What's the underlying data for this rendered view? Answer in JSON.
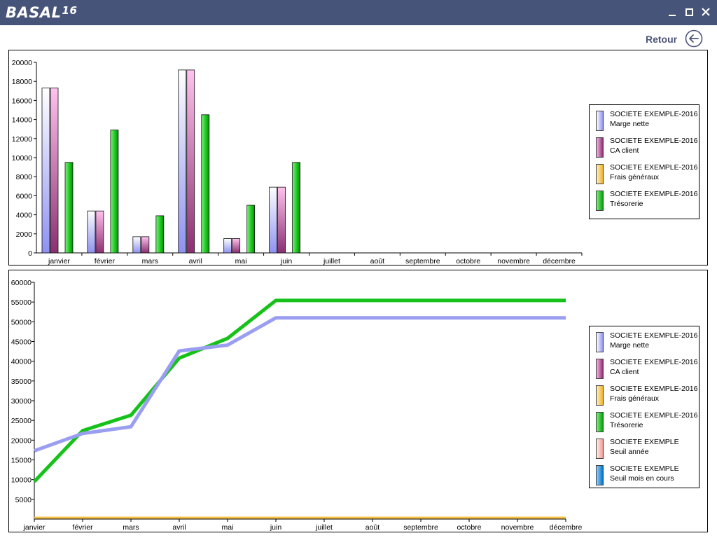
{
  "app": {
    "logo": "BASAL",
    "logo_sup": "16"
  },
  "window_controls": {
    "minimize_icon": "minimize-icon",
    "maximize_icon": "maximize-icon",
    "close_icon": "close-icon"
  },
  "nav": {
    "back_label": "Retour",
    "back_icon": "arrow-left-circle-icon"
  },
  "colors": {
    "titlebar": "#475479",
    "marge_nette": "#9a9ef0",
    "ca_client": "#a04a86",
    "frais_generaux": "#f4c04a",
    "tresorerie": "#16c21a",
    "seuil_annee": "#f29a92",
    "seuil_mois": "#1a8ad8"
  },
  "chart_data": [
    {
      "type": "bar",
      "categories": [
        "janvier",
        "février",
        "mars",
        "avril",
        "mai",
        "juin",
        "juillet",
        "août",
        "septembre",
        "octobre",
        "novembre",
        "décembre"
      ],
      "ylim": [
        0,
        20000
      ],
      "yticks": [
        0,
        2000,
        4000,
        6000,
        8000,
        10000,
        12000,
        14000,
        16000,
        18000,
        20000
      ],
      "legend_position": "right",
      "series": [
        {
          "name": "SOCIETE EXEMPLE-2016",
          "subname": "Marge nette",
          "values": [
            17300,
            4400,
            1700,
            19200,
            1500,
            6900,
            0,
            0,
            0,
            0,
            0,
            0
          ]
        },
        {
          "name": "SOCIETE EXEMPLE-2016",
          "subname": "CA client",
          "values": [
            17300,
            4400,
            1700,
            19200,
            1500,
            6900,
            0,
            0,
            0,
            0,
            0,
            0
          ]
        },
        {
          "name": "SOCIETE EXEMPLE-2016",
          "subname": "Frais généraux",
          "values": [
            0,
            0,
            0,
            0,
            0,
            0,
            0,
            0,
            0,
            0,
            0,
            0
          ]
        },
        {
          "name": "SOCIETE EXEMPLE-2016",
          "subname": "Trésorerie",
          "values": [
            9500,
            12900,
            3900,
            14500,
            5000,
            9500,
            0,
            0,
            0,
            0,
            0,
            0
          ]
        }
      ]
    },
    {
      "type": "line",
      "categories": [
        "janvier",
        "février",
        "mars",
        "avril",
        "mai",
        "juin",
        "juillet",
        "août",
        "septembre",
        "octobre",
        "novembre",
        "décembre"
      ],
      "ylim": [
        0,
        60000
      ],
      "yticks": [
        5000,
        10000,
        15000,
        20000,
        25000,
        30000,
        35000,
        40000,
        45000,
        50000,
        55000,
        60000
      ],
      "legend_position": "right",
      "series": [
        {
          "name": "SOCIETE EXEMPLE-2016",
          "subname": "Marge nette",
          "values": [
            17300,
            21700,
            23400,
            42600,
            44100,
            51000,
            51000,
            51000,
            51000,
            51000,
            51000,
            51000
          ]
        },
        {
          "name": "SOCIETE EXEMPLE-2016",
          "subname": "CA client",
          "values": [
            null,
            null,
            null,
            null,
            null,
            null,
            null,
            null,
            null,
            null,
            null,
            null
          ]
        },
        {
          "name": "SOCIETE EXEMPLE-2016",
          "subname": "Frais généraux",
          "values": [
            0,
            0,
            0,
            0,
            0,
            0,
            0,
            0,
            0,
            0,
            0,
            0
          ]
        },
        {
          "name": "SOCIETE EXEMPLE-2016",
          "subname": "Trésorerie",
          "values": [
            9500,
            22400,
            26300,
            40800,
            45800,
            55400,
            55400,
            55400,
            55400,
            55400,
            55400,
            55400
          ]
        },
        {
          "name": "SOCIETE EXEMPLE",
          "subname": "Seuil année",
          "values": [
            null,
            null,
            null,
            null,
            null,
            null,
            null,
            null,
            null,
            null,
            null,
            null
          ]
        },
        {
          "name": "SOCIETE EXEMPLE",
          "subname": "Seuil mois en cours",
          "values": [
            null,
            null,
            null,
            null,
            null,
            null,
            null,
            null,
            null,
            null,
            null,
            null
          ]
        }
      ]
    }
  ]
}
